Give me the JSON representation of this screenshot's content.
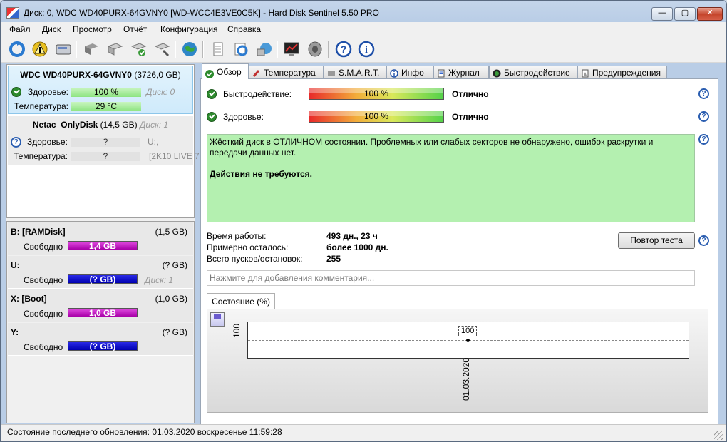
{
  "window": {
    "title": "Диск: 0, WDC WD40PURX-64GVNY0 [WD-WCC4E3VE0C5K]  -  Hard Disk Sentinel 5.50 PRO",
    "min_glyph": "—",
    "max_glyph": "▢",
    "close_glyph": "✕"
  },
  "menu": [
    "Файл",
    "Диск",
    "Просмотр",
    "Отчёт",
    "Конфигурация",
    "Справка"
  ],
  "toolbar_icons": [
    "refresh-icon",
    "warning-icon",
    "disk-icon",
    "disk-grey-icon",
    "disk-usb-icon",
    "disk-check-icon",
    "disk-wrench-icon",
    "globe-icon",
    "report-icon",
    "sync-icon",
    "network-icon",
    "chart-icon",
    "speaker-icon",
    "help-icon",
    "info-icon"
  ],
  "disks": [
    {
      "model": "WDC WD40PURX-64GVNY0",
      "capacity": "(3726,0 GB)",
      "health_label": "Здоровье:",
      "health_value": "100 %",
      "disk_note": "Диск: 0",
      "temp_label": "Температура:",
      "temp_value": "29 °C"
    },
    {
      "vendor": "Netac",
      "model": "OnlyDisk",
      "capacity": "(14,5 GB)",
      "disk_note": "Диск: 1",
      "health_label": "Здоровье:",
      "health_value": "?",
      "drive_letter": "U:,",
      "temp_label": "Температура:",
      "temp_value": "?",
      "extra_note": "[2K10 LIVE 7"
    }
  ],
  "volumes": [
    {
      "name": "B: [RAMDisk]",
      "size": "(1,5 GB)",
      "free_label": "Свободно",
      "free_value": "1,4 GB",
      "note": "",
      "color": "#c000c0"
    },
    {
      "name": "U:",
      "size": "(? GB)",
      "free_label": "Свободно",
      "free_value": "(? GB)",
      "note": "Диск: 1",
      "color": "#0000cc"
    },
    {
      "name": "X: [Boot]",
      "size": "(1,0 GB)",
      "free_label": "Свободно",
      "free_value": "1,0 GB",
      "note": "",
      "color": "#c000c0"
    },
    {
      "name": "Y:",
      "size": "(? GB)",
      "free_label": "Свободно",
      "free_value": "(? GB)",
      "note": "",
      "color": "#0000cc"
    }
  ],
  "tabs": [
    "Обзор",
    "Температура",
    "S.M.A.R.T.",
    "Инфо",
    "Журнал",
    "Быстродействие",
    "Предупреждения"
  ],
  "overview": {
    "performance_label": "Быстродействие:",
    "performance_value": "100 %",
    "performance_fraction": 1.0,
    "performance_rating": "Отлично",
    "health_label": "Здоровье:",
    "health_value": "100 %",
    "health_fraction": 1.0,
    "health_rating": "Отлично",
    "message_line1": "Жёсткий диск в ОТЛИЧНОМ состоянии. Проблемных или слабых секторов не обнаружено, ошибок раскрутки и передачи данных нет.",
    "message_line2": "Действия не требуются.",
    "uptime_label": "Время работы:",
    "uptime_value": "493 дн., 23 ч",
    "remaining_label": "Примерно осталось:",
    "remaining_value": "более 1000 дн.",
    "starts_label": "Всего пусков/остановок:",
    "starts_value": "255",
    "retest_button": "Повтор теста",
    "comment_placeholder": "Нажмите для добавления комментария...",
    "state_tab": "Состояние (%)"
  },
  "chart_data": {
    "type": "line",
    "x": [
      "01.03.2020"
    ],
    "series": [
      {
        "values": [
          100
        ]
      }
    ],
    "data_labels": [
      "100"
    ],
    "y_tick_labels": [
      "100"
    ]
  },
  "status_bar": "Состояние последнего обновления: 01.03.2020 воскресенье 11:59:28"
}
